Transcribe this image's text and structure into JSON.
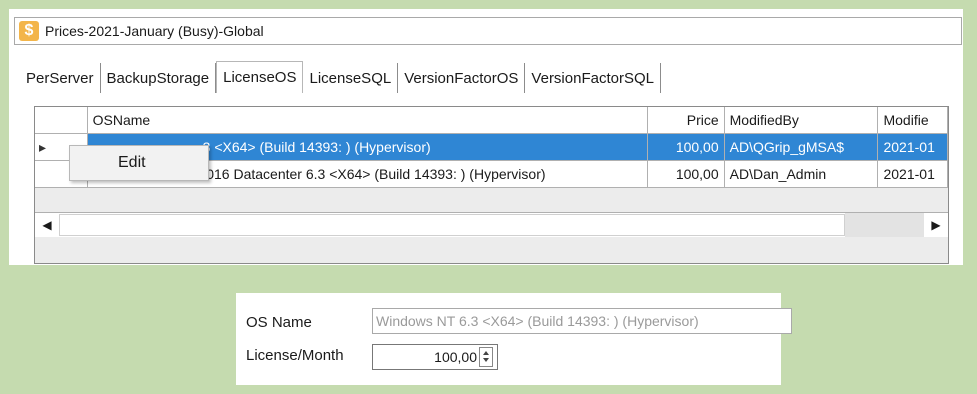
{
  "window": {
    "title": "Prices-2021-January (Busy)-Global",
    "icon": "dollar-icon"
  },
  "tabs": [
    {
      "label": "PerServer",
      "active": false
    },
    {
      "label": "BackupStorage",
      "active": false
    },
    {
      "label": "LicenseOS",
      "active": true
    },
    {
      "label": "LicenseSQL",
      "active": false
    },
    {
      "label": "VersionFactorOS",
      "active": false
    },
    {
      "label": "VersionFactorSQL",
      "active": false
    }
  ],
  "grid": {
    "columns": [
      "OSName",
      "Price",
      "ModifiedBy",
      "Modifie"
    ],
    "rows": [
      {
        "os_name": "3 <X64> (Build 14393: ) (Hypervisor)",
        "price": "100,00",
        "modified_by": "AD\\QGrip_gMSA$",
        "modified": "2021-01"
      },
      {
        "os_name": "Windows Server 2016 Datacenter 6.3 <X64> (Build 14393: ) (Hypervisor)",
        "price": "100,00",
        "modified_by": "AD\\Dan_Admin",
        "modified": "2021-01"
      }
    ]
  },
  "context_menu": {
    "items": [
      "Edit"
    ]
  },
  "form": {
    "os_name_label": "OS Name",
    "os_name_value": "Windows NT 6.3 <X64> (Build 14393: ) (Hypervisor)",
    "license_label": "License/Month",
    "license_value": "100,00"
  },
  "colors": {
    "accent_background": "#c5dbaf",
    "selection": "#2f86d4",
    "icon": "#f3b54a"
  }
}
